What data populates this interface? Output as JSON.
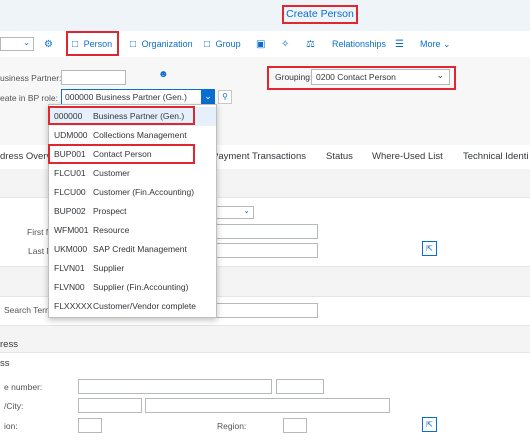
{
  "titlebar": {
    "title": "Create Person"
  },
  "toolbar": {
    "person_label": "Person",
    "organization_label": "Organization",
    "group_label": "Group",
    "relationships_label": "Relationships",
    "more_label": "More"
  },
  "header": {
    "business_partner_label": "usiness Partner:",
    "create_in_role_label": "eate in BP role:",
    "role_value": "000000 Business Partner (Gen.)",
    "grouping_label": "Grouping:",
    "grouping_value": "0200 Contact Person"
  },
  "tabs": [
    "dress Overv",
    "Payment Transactions",
    "Status",
    "Where-Used List",
    "Technical Identi"
  ],
  "form": {
    "first_name_label": "First N",
    "last_name_label": "Last N",
    "search_term_label": "Search Term",
    "section_address": "ress",
    "section_sub": "ss",
    "phone_label": "e number:",
    "city_label": "/City:",
    "region_label_left": "ion:",
    "region_label": "Region:"
  },
  "dropdown": {
    "options": [
      {
        "code": "000000",
        "desc": "Business Partner (Gen.)"
      },
      {
        "code": "UDM000",
        "desc": "Collections Management"
      },
      {
        "code": "BUP001",
        "desc": "Contact Person"
      },
      {
        "code": "FLCU01",
        "desc": "Customer"
      },
      {
        "code": "FLCU00",
        "desc": "Customer (Fin.Accounting)"
      },
      {
        "code": "BUP002",
        "desc": "Prospect"
      },
      {
        "code": "WFM001",
        "desc": "Resource"
      },
      {
        "code": "UKM000",
        "desc": "SAP Credit Management"
      },
      {
        "code": "FLVN01",
        "desc": "Supplier"
      },
      {
        "code": "FLVN00",
        "desc": "Supplier (Fin.Accounting)"
      },
      {
        "code": "FLXXXXX",
        "desc": "Customer/Vendor complete"
      }
    ]
  },
  "colors": {
    "accent": "#0a6ed1",
    "highlight_box": "#e0262e",
    "shell_bg": "#eff4f9"
  }
}
